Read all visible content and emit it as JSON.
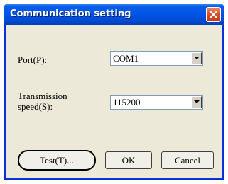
{
  "window": {
    "title": "Communication setting"
  },
  "port": {
    "label": "Port(P):",
    "value": "COM1"
  },
  "speed": {
    "label_line1": "Transmission",
    "label_line2": "speed(S):",
    "value": "115200"
  },
  "buttons": {
    "test": "Test(T)...",
    "ok": "OK",
    "cancel": "Cancel"
  },
  "icons": {
    "close": "close-icon",
    "dropdown": "chevron-down-icon"
  },
  "colors": {
    "titlebar": "#0055e5",
    "close_button": "#d9532c",
    "dialog_background": "#ece9d8"
  }
}
